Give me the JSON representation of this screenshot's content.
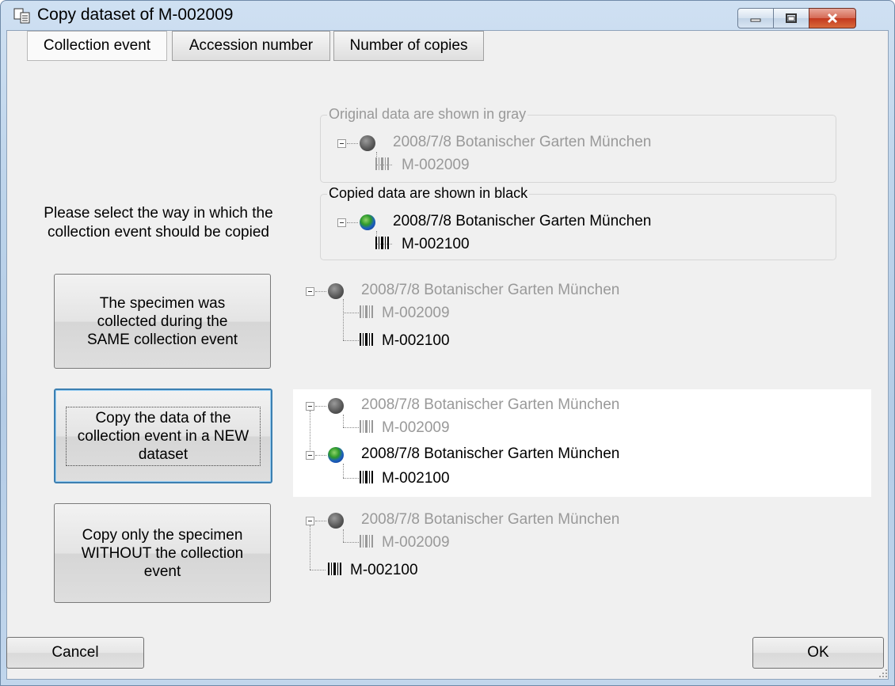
{
  "window": {
    "title": "Copy dataset of M-002009",
    "title_icon": "copy-icon",
    "controls": [
      "minimize-icon",
      "maximize-icon",
      "close-icon"
    ]
  },
  "tabs": [
    {
      "label": "Collection event",
      "active": true
    },
    {
      "label": "Accession number",
      "active": false
    },
    {
      "label": "Number of copies",
      "active": false
    }
  ],
  "legend": {
    "original_caption": "Original data are shown in gray",
    "copied_caption": "Copied data are shown in black"
  },
  "original_tree": {
    "event": "2008/7/8 Botanischer Garten München",
    "specimen": "M-002009"
  },
  "copied_tree": {
    "event": "2008/7/8 Botanischer Garten München",
    "specimen": "M-002100"
  },
  "prompt": "Please select the way in which the collection event should be copied",
  "options": [
    {
      "label": "The specimen was collected during the SAME collection event",
      "tree": {
        "event": "2008/7/8 Botanischer Garten München",
        "original_specimen": "M-002009",
        "new_specimen": "M-002100"
      }
    },
    {
      "label": "Copy the data of the collection event in a NEW dataset",
      "tree": {
        "event": "2008/7/8 Botanischer Garten München",
        "original_specimen": "M-002009",
        "new_event": "2008/7/8 Botanischer Garten München",
        "new_specimen": "M-002100"
      }
    },
    {
      "label": "Copy only the specimen WITHOUT the collection event",
      "tree": {
        "event": "2008/7/8 Botanischer Garten München",
        "original_specimen": "M-002009",
        "new_specimen": "M-002100"
      }
    }
  ],
  "footer": {
    "cancel_label": "Cancel",
    "ok_label": "OK"
  },
  "colors": {
    "original_text": "#999999",
    "copied_text": "#000000",
    "focus_border": "#3c7fb1"
  }
}
